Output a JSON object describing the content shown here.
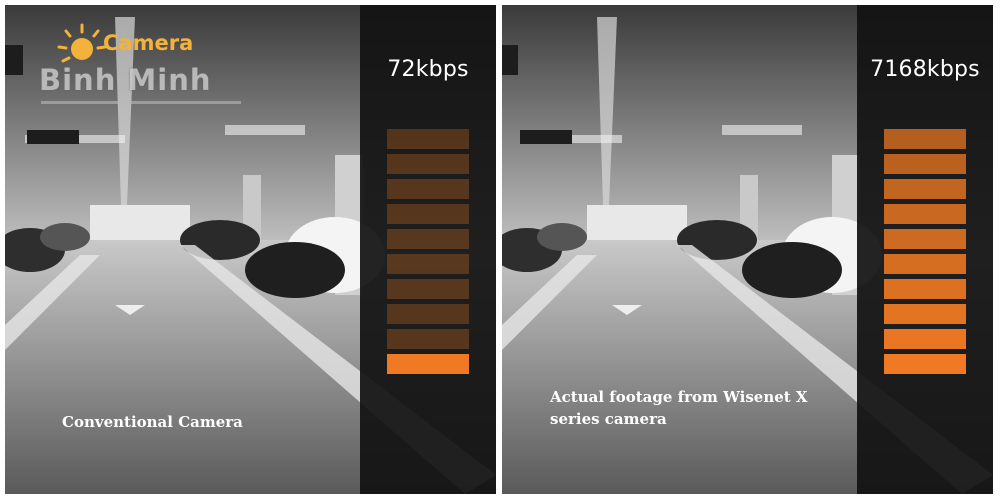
{
  "logo": {
    "camera_text": "Camera",
    "brand_text": "Binh Minh",
    "sun_color": "#f3b33a"
  },
  "left": {
    "bitrate_label": "72kbps",
    "caption": "Conventional Camera",
    "bar_level": 0.1,
    "bar_segments": 10,
    "bar_color": "#f07a23"
  },
  "right": {
    "bitrate_label": "7168kbps",
    "caption": "Actual footage from Wisenet X series camera",
    "bar_level": 1.0,
    "bar_segments": 10,
    "bar_color": "#f07a23"
  }
}
